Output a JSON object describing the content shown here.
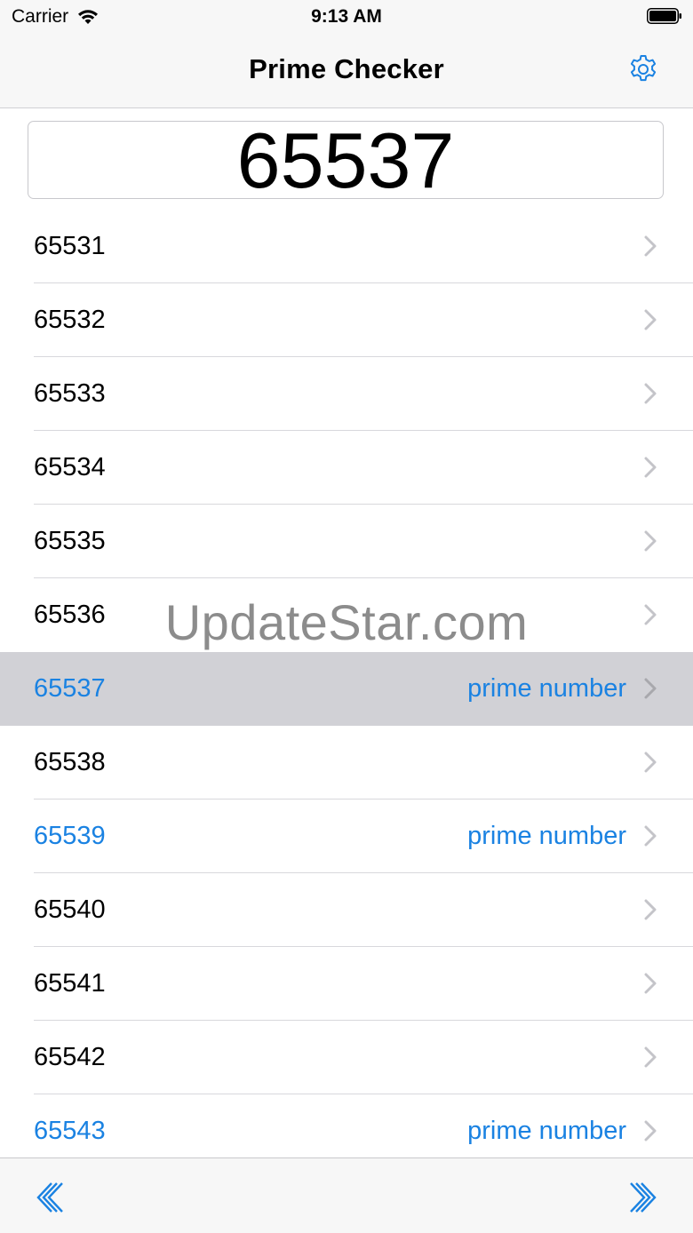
{
  "status_bar": {
    "carrier": "Carrier",
    "time": "9:13 AM"
  },
  "nav": {
    "title": "Prime Checker",
    "settings_icon": "gear-icon"
  },
  "input": {
    "value": "65537"
  },
  "rows": [
    {
      "number": "65531",
      "label": ""
    },
    {
      "number": "65532",
      "label": ""
    },
    {
      "number": "65533",
      "label": ""
    },
    {
      "number": "65534",
      "label": ""
    },
    {
      "number": "65535",
      "label": ""
    },
    {
      "number": "65536",
      "label": ""
    },
    {
      "number": "65537",
      "label": "prime number",
      "selected": true
    },
    {
      "number": "65538",
      "label": ""
    },
    {
      "number": "65539",
      "label": "prime number"
    },
    {
      "number": "65540",
      "label": ""
    },
    {
      "number": "65541",
      "label": ""
    },
    {
      "number": "65542",
      "label": ""
    },
    {
      "number": "65543",
      "label": "prime number"
    }
  ],
  "watermark": "UpdateStar.com",
  "toolbar": {
    "prev_icon": "double-chevron-left-icon",
    "next_icon": "double-chevron-right-icon"
  },
  "colors": {
    "accent": "#1a82e2",
    "selected_row": "#d1d1d6",
    "bar_bg": "#f7f7f7"
  }
}
